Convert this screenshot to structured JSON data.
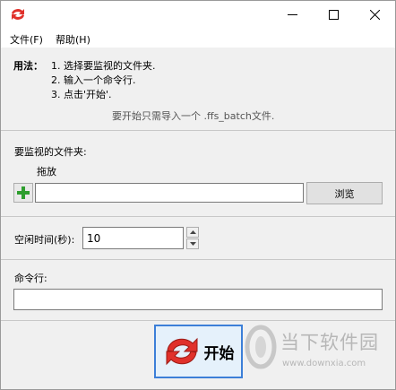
{
  "titlebar": {
    "buttons": [
      "minimize",
      "maximize",
      "close"
    ]
  },
  "menu": {
    "file": "文件(F)",
    "help": "帮助(H)"
  },
  "usage": {
    "label": "用法：",
    "steps": [
      "1. 选择要监视的文件夹.",
      "2. 输入一个命令行.",
      "3. 点击'开始'."
    ],
    "hint": "要开始只需导入一个 .ffs_batch文件."
  },
  "folder_section": {
    "label": "要监视的文件夹:",
    "drop_label": "拖放",
    "input_value": "",
    "browse_label": "浏览"
  },
  "idle": {
    "label": "空闲时间(秒):",
    "value": "10"
  },
  "command": {
    "label": "命令行:",
    "value": ""
  },
  "start": {
    "label": "开始"
  },
  "watermark": {
    "text": "当下软件园",
    "url": "www.downxia.com"
  },
  "colors": {
    "accent": "#3c7fd8",
    "icon_red": "#e0312b",
    "add_green": "#2e9e2e"
  },
  "icons": [
    "app-sync-icon",
    "minimize-icon",
    "maximize-icon",
    "close-icon",
    "plus-icon",
    "spin-up-icon",
    "spin-down-icon",
    "sync-icon"
  ]
}
